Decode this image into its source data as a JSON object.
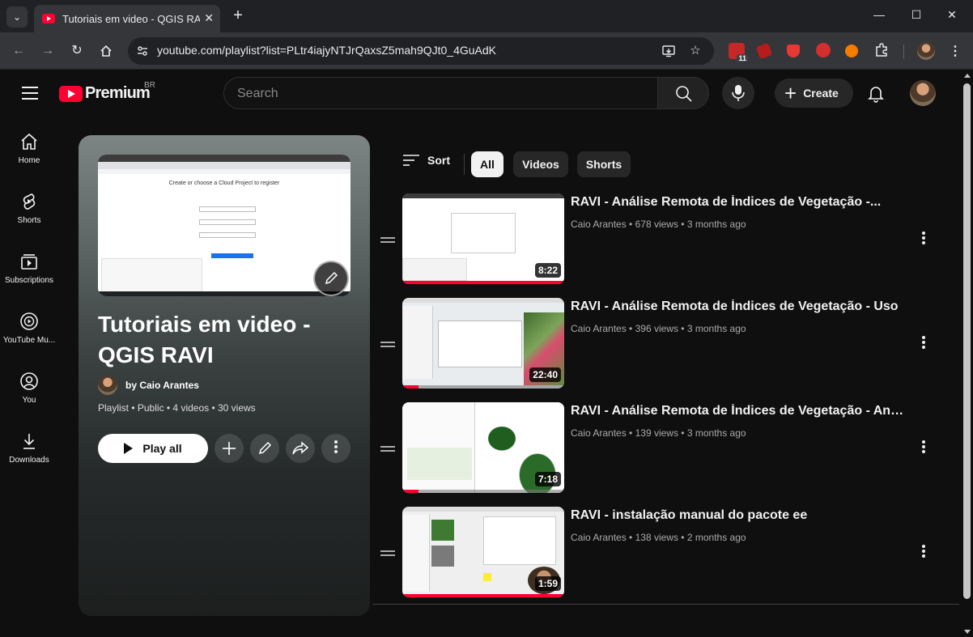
{
  "browser": {
    "tab_title": "Tutoriais em video - QGIS RAVI",
    "tab_close": "✕",
    "new_tab": "+",
    "url": "youtube.com/playlist?list=PLtr4iajyNTJrQaxsZ5mah9QJt0_4GuAdK",
    "extension_badge": "11"
  },
  "header": {
    "logo_text": "Premium",
    "country_code": "BR",
    "search_placeholder": "Search",
    "create_label": "Create"
  },
  "sidenav": {
    "items": [
      {
        "label": "Home",
        "icon": "home-icon"
      },
      {
        "label": "Shorts",
        "icon": "shorts-icon"
      },
      {
        "label": "Subscriptions",
        "icon": "subscriptions-icon"
      },
      {
        "label": "YouTube Mu...",
        "icon": "youtube-music-icon"
      },
      {
        "label": "You",
        "icon": "you-icon"
      },
      {
        "label": "Downloads",
        "icon": "downloads-icon"
      }
    ]
  },
  "playlist": {
    "title": "Tutoriais em video - QGIS RAVI",
    "owner": "by Caio Arantes",
    "meta": "Playlist • Public • 4 videos • 30 views",
    "play_all": "Play all",
    "thumb_caption": "Create or choose a Cloud Project to register"
  },
  "filters": {
    "sort_label": "Sort",
    "chips": [
      "All",
      "Videos",
      "Shorts"
    ],
    "active": "All"
  },
  "videos": [
    {
      "title": "RAVI - Análise Remota de Índices de Vegetação -...",
      "channel": "Caio Arantes",
      "views": "678 views",
      "age": "3 months ago",
      "duration": "8:22",
      "progress": 1.0
    },
    {
      "title": "RAVI - Análise Remota de Índices de Vegetação - Uso",
      "channel": "Caio Arantes",
      "views": "396 views",
      "age": "3 months ago",
      "duration": "22:40",
      "progress": 0.1
    },
    {
      "title": "RAVI - Análise Remota de Índices de Vegetação - Anális...",
      "channel": "Caio Arantes",
      "views": "139 views",
      "age": "3 months ago",
      "duration": "7:18",
      "progress": 0.1
    },
    {
      "title": "RAVI - instalação manual do pacote ee",
      "channel": "Caio Arantes",
      "views": "138 views",
      "age": "2 months ago",
      "duration": "1:59",
      "progress": 1.0
    }
  ],
  "colors": {
    "accent": "#ff0033",
    "background": "#0f0f0f",
    "chip_bg": "#272727"
  }
}
